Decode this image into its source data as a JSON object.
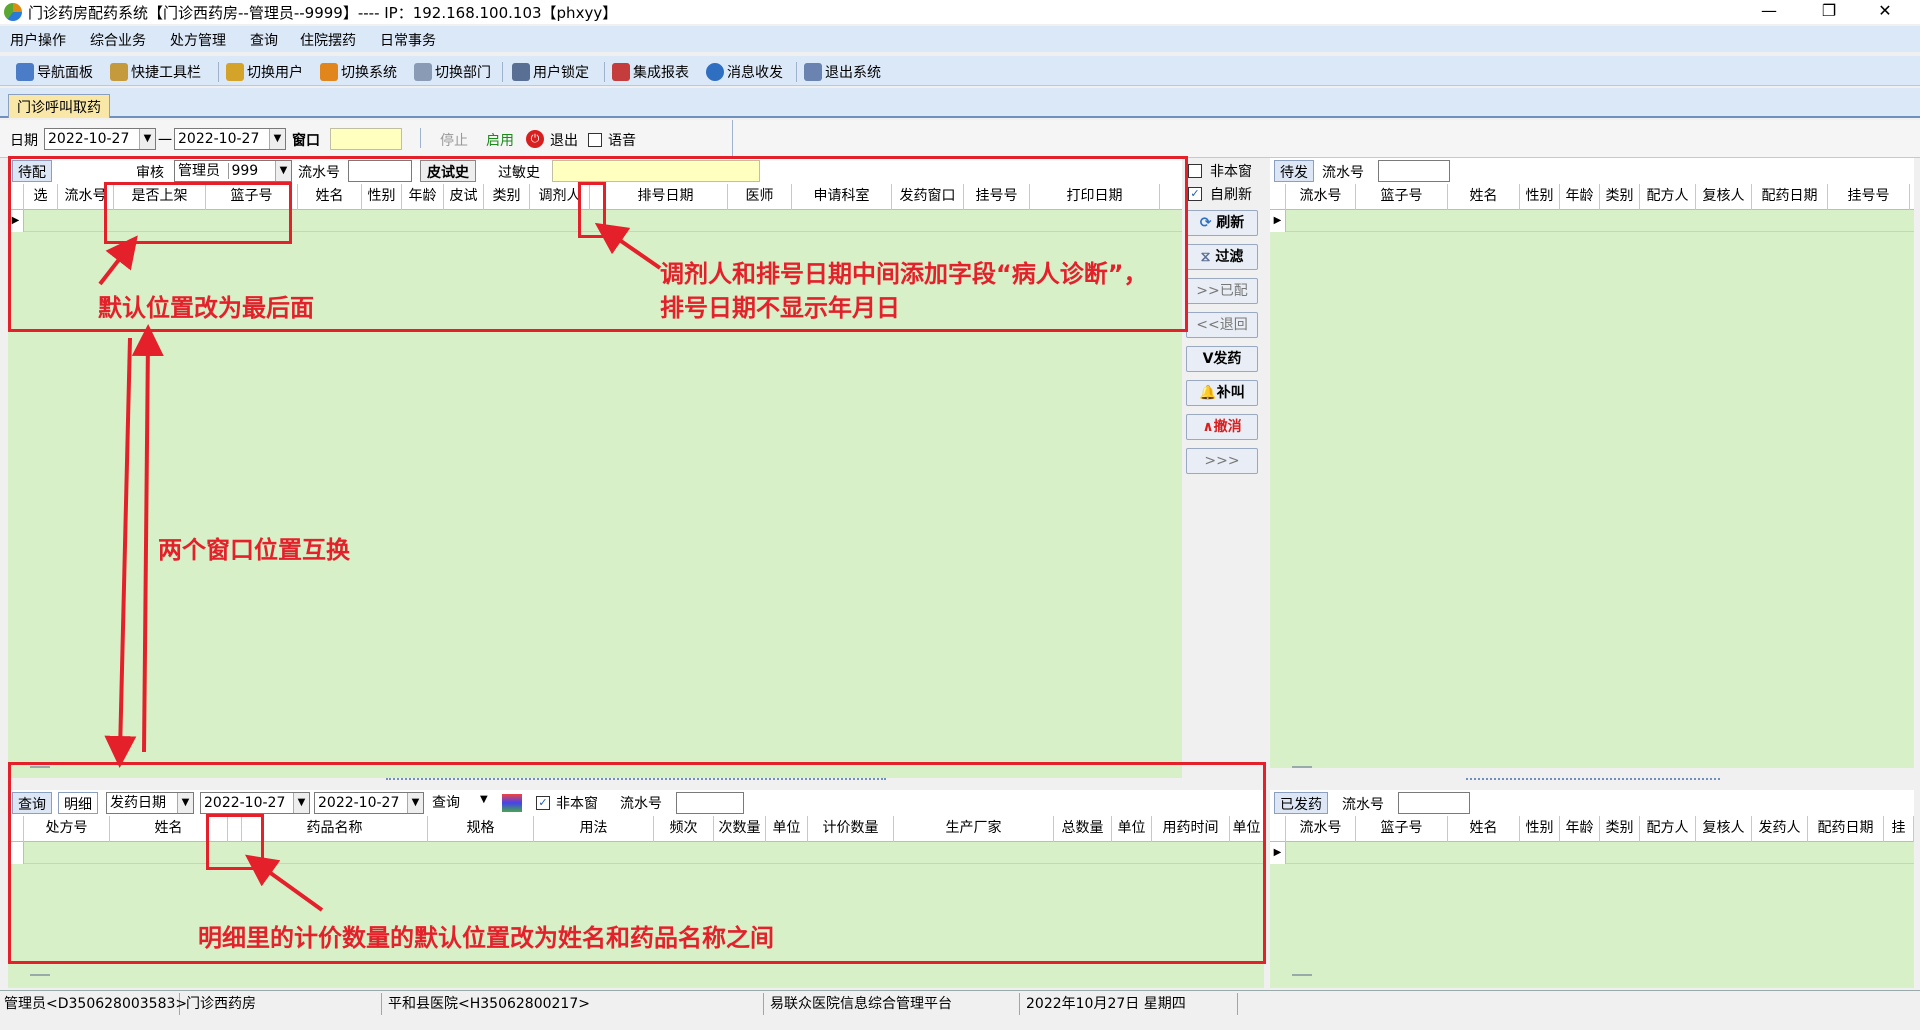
{
  "window": {
    "title": "门诊药房配药系统【门诊西药房--管理员--9999】---- IP：192.168.100.103【phxyy】",
    "min": "—",
    "max": "❐",
    "close": "✕"
  },
  "menu": [
    "用户操作",
    "综合业务",
    "处方管理",
    "查询",
    "住院摆药",
    "日常事务"
  ],
  "toolbar": [
    "导航面板",
    "快捷工具栏",
    "切换用户",
    "切换系统",
    "切换部门",
    "用户锁定",
    "集成报表",
    "消息收发",
    "退出系统"
  ],
  "main_tab": "门诊呼叫取药",
  "filter": {
    "date_label": "日期",
    "date_from": "2022-10-27",
    "dash": "一",
    "date_to": "2022-10-27",
    "window_label": "窗口",
    "window_value": "",
    "stop": "停止",
    "enable": "启用",
    "exit": "退出",
    "voice": "语音"
  },
  "pending": {
    "tab": "待配",
    "review_label": "审核",
    "reviewer": "管理员",
    "reviewer_code": "999",
    "serial_label": "流水号",
    "skin_history": "皮试史",
    "allergy_label": "过敏史",
    "columns": [
      "选",
      "流水号",
      "是否上架",
      "篮子号",
      "姓名",
      "性别",
      "年龄",
      "皮试",
      "类别",
      "调剂人",
      "",
      "排号日期",
      "医师",
      "申请科室",
      "发药窗口",
      "挂号号",
      "打印日期"
    ]
  },
  "side": {
    "not_this_window": "非本窗",
    "auto_refresh": "自刷新",
    "buttons": [
      "刷新",
      "过滤",
      ">>已配",
      "<<退回",
      "V发药",
      "补叫",
      "∧撤消",
      ">>>"
    ]
  },
  "to_send": {
    "tab": "待发",
    "serial_label": "流水号",
    "columns": [
      "流水号",
      "篮子号",
      "姓名",
      "性别",
      "年龄",
      "类别",
      "配方人",
      "复核人",
      "配药日期",
      "挂号号"
    ]
  },
  "detail": {
    "tab_query": "查询",
    "tab_detail": "明细",
    "date_type": "发药日期",
    "date_from": "2022-10-27",
    "date_to": "2022-10-27",
    "query_btn": "查询",
    "not_this_window": "非本窗",
    "serial_label": "流水号",
    "columns": [
      "处方号",
      "姓名",
      "",
      "药品名称",
      "规格",
      "用法",
      "频次",
      "次数量",
      "单位",
      "计价数量",
      "生产厂家",
      "总数量",
      "单位",
      "用药时间",
      "单位"
    ]
  },
  "sent": {
    "tab": "已发药",
    "serial_label": "流水号",
    "columns": [
      "流水号",
      "篮子号",
      "姓名",
      "性别",
      "年龄",
      "类别",
      "配方人",
      "复核人",
      "发药人",
      "配药日期",
      "挂"
    ]
  },
  "annotations": {
    "note1": "默认位置改为最后面",
    "note2_line1": "调剂人和排号日期中间添加字段“病人诊断”，",
    "note2_line2": "排号日期不显示年月日",
    "note3": "两个窗口位置互换",
    "note4": "明细里的计价数量的默认位置改为姓名和药品名称之间"
  },
  "status": [
    "管理员<D350628003583>",
    "门诊西药房",
    "平和县医院<H35062800217>",
    "易联众医院信息综合管理平台",
    "2022年10月27日  星期四"
  ]
}
